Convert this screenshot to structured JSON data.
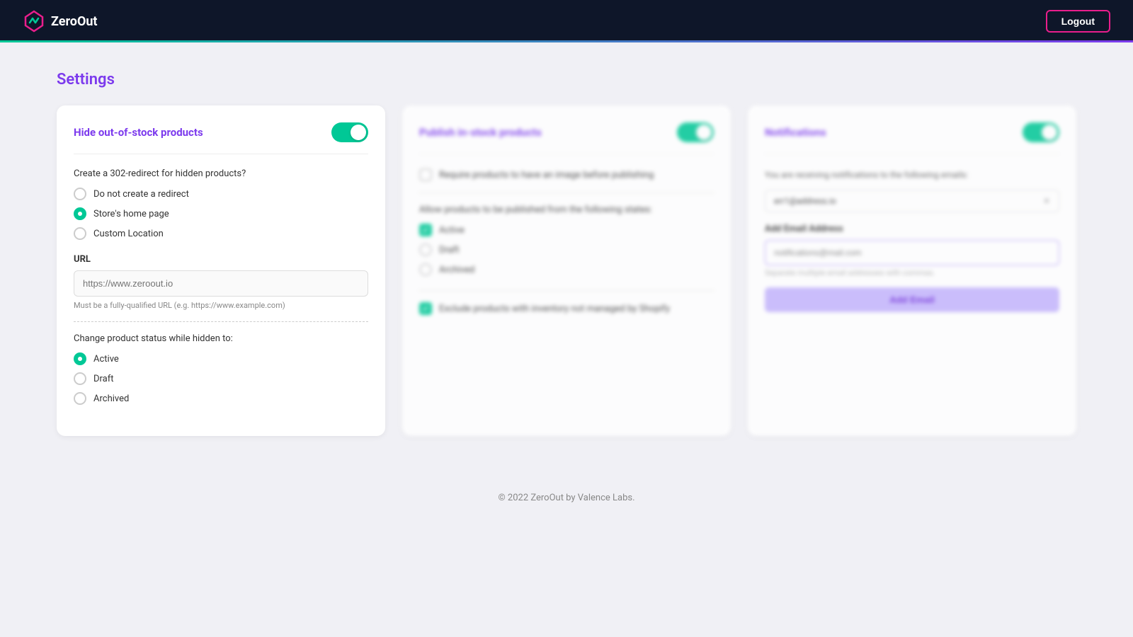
{
  "header": {
    "logo_text": "ZeroOut",
    "logout_label": "Logout"
  },
  "page": {
    "title": "Settings"
  },
  "card1": {
    "title": "Hide out-of-stock products",
    "toggle_on": true,
    "redirect_section_label": "Create a 302-redirect for hidden products?",
    "redirect_options": [
      {
        "label": "Do not create a redirect",
        "checked": false
      },
      {
        "label": "Store's home page",
        "checked": true
      },
      {
        "label": "Custom Location",
        "checked": false
      }
    ],
    "url_label": "URL",
    "url_placeholder": "https://www.zeroout.io",
    "url_hint": "Must be a fully-qualified URL (e.g. https://www.example.com)",
    "status_label": "Change product status while hidden to:",
    "status_options": [
      {
        "label": "Active",
        "checked": true
      },
      {
        "label": "Draft",
        "checked": false
      },
      {
        "label": "Archived",
        "checked": false
      }
    ]
  },
  "card2": {
    "title": "Publish in-stock products",
    "toggle_on": true,
    "require_image_label": "Require products to have an image before publishing",
    "allow_publish_label": "Allow products to be published from the following states:",
    "states": [
      {
        "label": "Active",
        "checked": true
      },
      {
        "label": "Draft",
        "checked": false
      },
      {
        "label": "Archived",
        "checked": false
      }
    ],
    "exclude_label": "Exclude products with inventory not managed by Shopify",
    "exclude_checked": true
  },
  "card3": {
    "title": "Notifications",
    "toggle_on": true,
    "notif_text": "You are receiving notifications to the following emails:",
    "email_tag": "err1@address.io",
    "add_email_label": "Add Email Address",
    "email_placeholder": "notifications@mail.com",
    "email_hint": "Separate multiple email addresses with commas.",
    "add_button_label": "Add Email"
  },
  "footer": {
    "text": "© 2022 ZeroOut by Valence Labs."
  }
}
